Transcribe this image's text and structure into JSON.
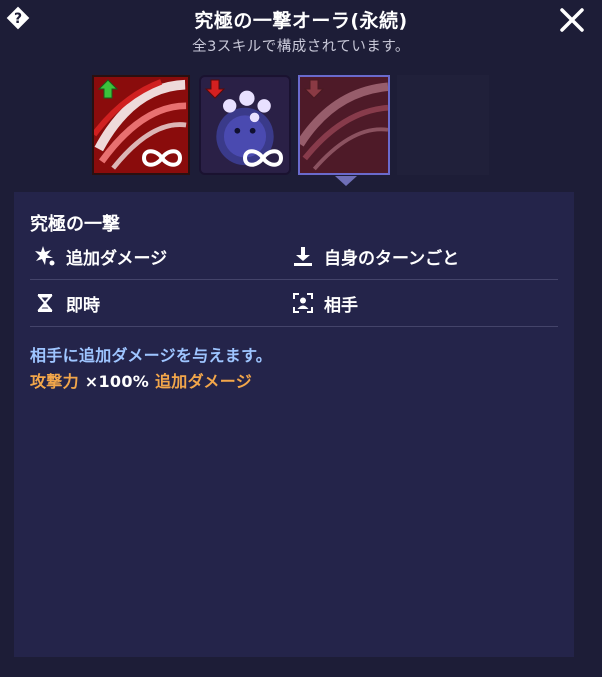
{
  "header": {
    "title": "究極の一撃オーラ(永続)",
    "subtitle": "全3スキルで構成されています。",
    "help_icon": "question-diamond-icon",
    "close_icon": "close-x-icon"
  },
  "skill_icons": [
    {
      "name": "red-slash-buff",
      "status": "up-arrow",
      "infinite": true
    },
    {
      "name": "purple-blob-debuff",
      "status": "down-arrow",
      "infinite": true
    },
    {
      "name": "red-slash-debuff-selected",
      "status": "down-arrow",
      "infinite": false,
      "selected": true
    },
    {
      "name": "empty-slot"
    }
  ],
  "detail": {
    "skill_name": "究極の一撃",
    "attributes": {
      "type": "追加ダメージ",
      "timing": "自身のターンごと",
      "duration": "即時",
      "target": "相手"
    },
    "description": "相手に追加ダメージを与えます。",
    "effect": {
      "stat": "攻撃力",
      "multiplier": "×100%",
      "kind": "追加ダメージ"
    }
  },
  "colors": {
    "background": "#1d1d37",
    "panel": "#24244a",
    "description_text": "#9ec5ff",
    "highlight_orange": "#f2a64a",
    "selected_border": "#6a6acc"
  }
}
